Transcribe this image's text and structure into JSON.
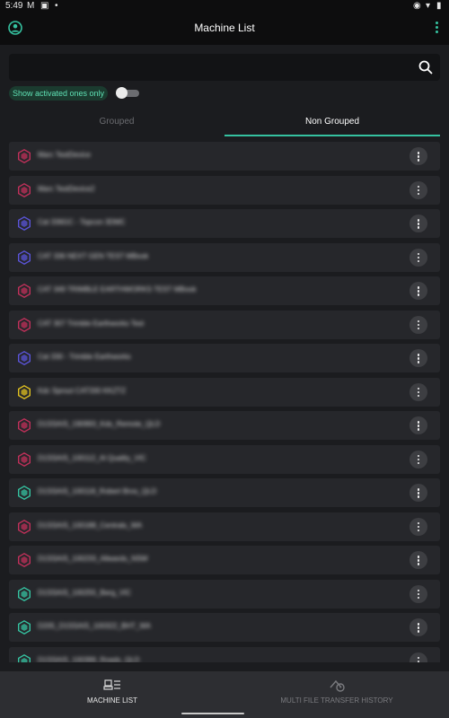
{
  "status_bar": {
    "time": "5:49"
  },
  "app_bar": {
    "title": "Machine List"
  },
  "search": {
    "placeholder": ""
  },
  "filter": {
    "chip_label": "Show activated ones only",
    "activated_only": false
  },
  "tabs": [
    {
      "label": "Grouped",
      "selected": false
    },
    {
      "label": "Non Grouped",
      "selected": true
    }
  ],
  "machines": [
    {
      "name": "Marc TestDevice",
      "status_color": "#c0305a"
    },
    {
      "name": "Marc TestDevice2",
      "status_color": "#c0305a"
    },
    {
      "name": "Cat 336GC - Topcon 3DMC",
      "status_color": "#5a54d8"
    },
    {
      "name": "CAT 336 NEXT GEN TEST MBook",
      "status_color": "#5a54d8"
    },
    {
      "name": "CAT 349 TRIMBLE EARTHWORKS TEST MBook",
      "status_color": "#c0305a"
    },
    {
      "name": "CAT 307 Trimble Earthworks Test",
      "status_color": "#c0305a"
    },
    {
      "name": "Cat 330 - Trimble Earthworks",
      "status_color": "#5a54d8"
    },
    {
      "name": "Kdc Sprout CAT330 KKZTZ",
      "status_color": "#e0c020"
    },
    {
      "name": "D1SSAIS_190993_Kds_Remote_QLD",
      "status_color": "#c0305a"
    },
    {
      "name": "D1SSAIS_100112_Al Quality_VIC",
      "status_color": "#c0305a"
    },
    {
      "name": "D1SSAIS_100118_Robert Bros_QLD",
      "status_color": "#35c2a0"
    },
    {
      "name": "D1SSAIS_100188_Centrals_WA",
      "status_color": "#c0305a"
    },
    {
      "name": "D1SSAIS_100233_Allwards_NSW",
      "status_color": "#c0305a"
    },
    {
      "name": "D1SSAIS_100255_Berg_VIC",
      "status_color": "#35c2a0"
    },
    {
      "name": "D205_D1SSAIS_100322_BHT_WA",
      "status_color": "#35c2a0"
    },
    {
      "name": "D1SSAIS_100399_Roads_QLD",
      "status_color": "#35c2a0"
    }
  ],
  "bottom_nav": [
    {
      "label": "MACHINE LIST",
      "icon": "machine-list-icon",
      "selected": true
    },
    {
      "label": "MULTI FILE TRANSFER HISTORY",
      "icon": "transfer-history-icon",
      "selected": false
    }
  ],
  "colors": {
    "accent": "#35c2a0",
    "background": "#1b1c1f",
    "row": "#26272b"
  }
}
